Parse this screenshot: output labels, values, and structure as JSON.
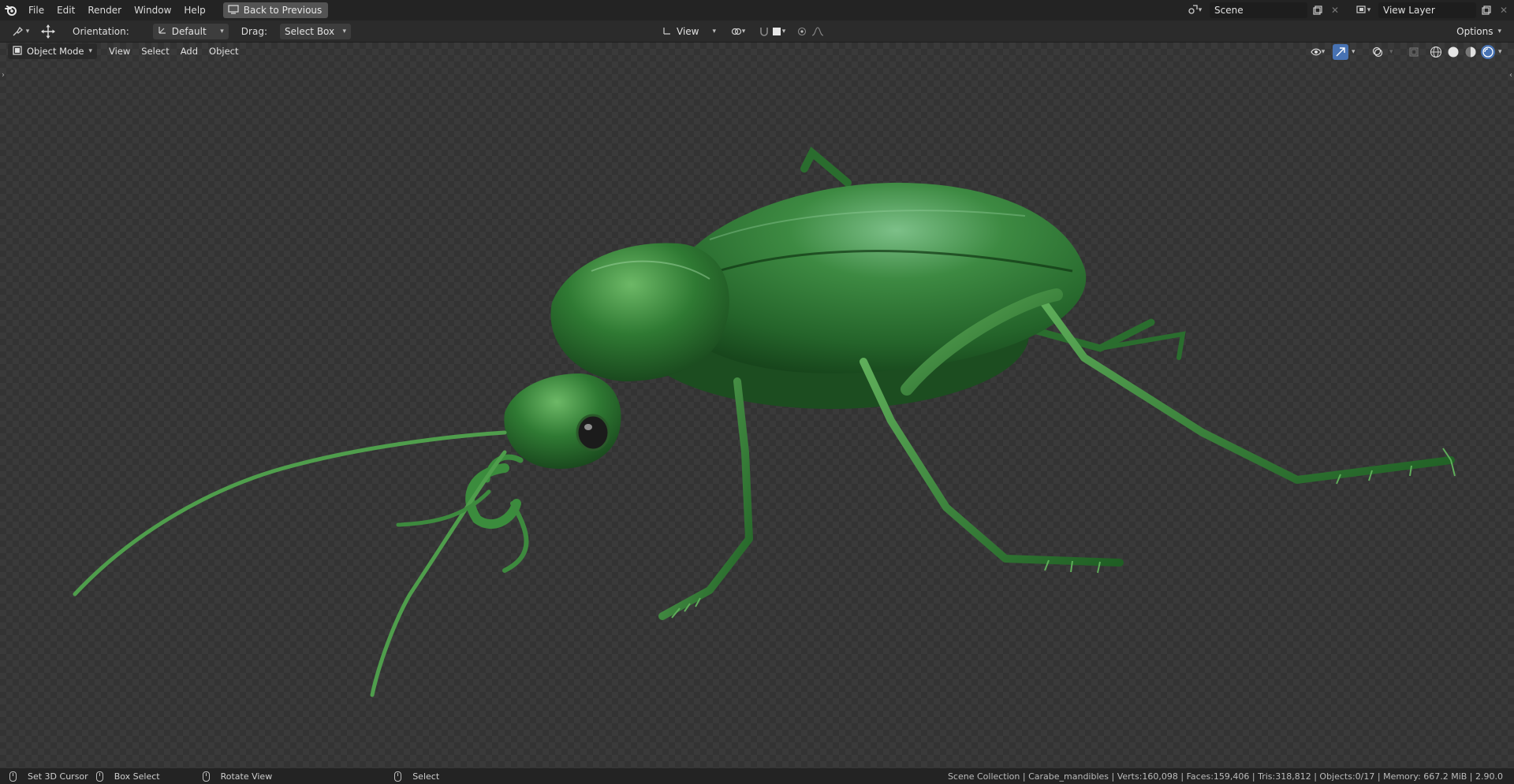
{
  "menubar": {
    "items": [
      "File",
      "Edit",
      "Render",
      "Window",
      "Help"
    ],
    "back_button": "Back to Previous",
    "scene_label": "Scene",
    "view_layer_label": "View Layer"
  },
  "tool_header": {
    "orientation_label": "Orientation:",
    "orientation_value": "Default",
    "drag_label": "Drag:",
    "drag_value": "Select Box",
    "transform_view": "View",
    "options_label": "Options"
  },
  "viewport_header": {
    "mode": "Object Mode",
    "menus": [
      "View",
      "Select",
      "Add",
      "Object"
    ]
  },
  "statusbar": {
    "set_cursor": "Set 3D Cursor",
    "box_select": "Box Select",
    "rotate_view": "Rotate View",
    "select": "Select",
    "stats": "Scene Collection | Carabe_mandibles | Verts:160,098 | Faces:159,406 | Tris:318,812 | Objects:0/17 | Memory: 667.2 MiB | 2.90.0"
  },
  "colors": {
    "accent": "#4772b3",
    "beetle_green": "#2f7a2f",
    "beetle_dark": "#163f16",
    "beetle_light": "#6fba6a"
  },
  "icons": [
    "blender-logo-icon",
    "screen-icon",
    "scene-icon",
    "new-scene-icon",
    "close-icon",
    "view-layer-icon",
    "editor-type-icon",
    "move-gizmo-icon",
    "orientation-icon",
    "transform-pivot-icon",
    "snap-icon",
    "proportional-icon",
    "visibility-icon",
    "gizmo-icon",
    "overlay-icon",
    "xray-icon",
    "wireframe-shading-icon",
    "solid-shading-icon",
    "material-shading-icon",
    "rendered-shading-icon"
  ]
}
